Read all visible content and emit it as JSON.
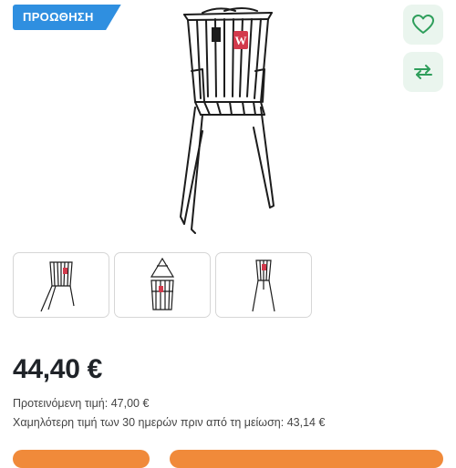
{
  "badge": {
    "label": "ΠΡΟΩΘΗΣΗ"
  },
  "product": {
    "price": "44,40 €",
    "recommended_label": "Προτεινόμενη τιμή:",
    "recommended_value": "47,00 €",
    "lowest_label": "Χαμηλότερη τιμή των 30 ημερών πριν από τη μείωση:",
    "lowest_value": "43,14 €"
  },
  "icons": {
    "wishlist": "heart-icon",
    "compare": "compare-arrows-icon"
  },
  "gallery": {
    "thumbnail_count": 3
  },
  "colors": {
    "badge": "#2f8fe0",
    "icon_green": "#2e9e5b",
    "action_bg": "#eaf5ee",
    "cta_orange": "#f08a3a"
  }
}
